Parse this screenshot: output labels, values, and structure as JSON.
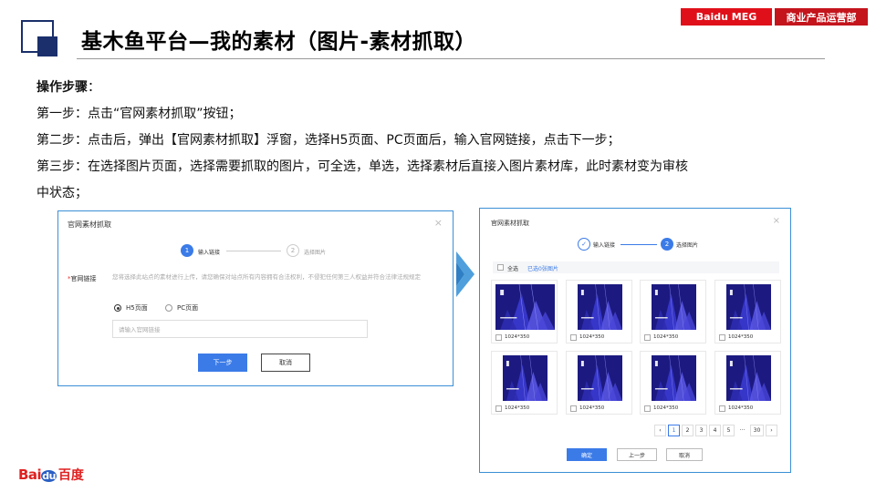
{
  "header": {
    "title": "基木鱼平台—我的素材（图片-素材抓取）",
    "tag_company": "Baidu MEG",
    "tag_department": "商业产品运营部"
  },
  "steps": {
    "heading": "操作步骤",
    "heading_colon": "：",
    "lines": [
      "第一步：点击“官网素材抓取”按钮；",
      "第二步：点击后，弹出【官网素材抓取】浮窗，选择H5页面、PC页面后，输入官网链接，点击下一步；",
      "第三步：在选择图片页面，选择需要抓取的图片，可全选，单选，选择素材后直接入图片素材库，此时素材变为审核",
      "中状态；"
    ]
  },
  "dialog1": {
    "title": "官网素材抓取",
    "close_icon": "close-icon",
    "step1_num": "1",
    "step1_label": "输入链接",
    "step2_num": "2",
    "step2_label": "选择图片",
    "field_required_mark": "*",
    "field_label": "官网链接",
    "hint": "您将选择此站点的素材进行上传，请您确保对站点所有内容拥有合法权利，不侵犯任何第三人权益并符合法律法规规定",
    "radio_h5": "H5页面",
    "radio_pc": "PC页面",
    "selected_radio": "H5页面",
    "url_placeholder": "请输入官网链接",
    "url_value": "",
    "next_button": "下一步",
    "cancel_button": "取消"
  },
  "dialog2": {
    "title": "官网素材抓取",
    "close_icon": "close-icon",
    "step1_icon": "check-icon",
    "step1_label": "输入链接",
    "step2_num": "2",
    "step2_label": "选择图片",
    "select_all": "全选",
    "selected_count": "已选0张图片",
    "images": [
      {
        "size": "1024*350",
        "layout": "wide"
      },
      {
        "size": "1024*350",
        "layout": "narrow"
      },
      {
        "size": "1024*350",
        "layout": "narrow"
      },
      {
        "size": "1024*350",
        "layout": "narrow"
      },
      {
        "size": "1024*350",
        "layout": "narrow"
      },
      {
        "size": "1024*350",
        "layout": "narrow"
      },
      {
        "size": "1024*350",
        "layout": "narrow"
      },
      {
        "size": "1024*350",
        "layout": "narrow"
      }
    ],
    "pagination": {
      "prev_icon": "chevron-left-icon",
      "pages": [
        "1",
        "2",
        "3",
        "4",
        "5"
      ],
      "current": "1",
      "ellipsis": "···",
      "last": "30",
      "next_icon": "chevron-right-icon"
    },
    "confirm_button": "确定",
    "prev_step_button": "上一步",
    "cancel_button": "取消"
  },
  "footer": {
    "logo_en_1": "Bai",
    "logo_en_2": "du",
    "logo_cn": "百度"
  },
  "colors": {
    "accent_blue": "#3b7be8",
    "title_navy": "#1a2f6b",
    "brand_red": "#e0101a",
    "screenshot_border": "#3b8fd6"
  }
}
